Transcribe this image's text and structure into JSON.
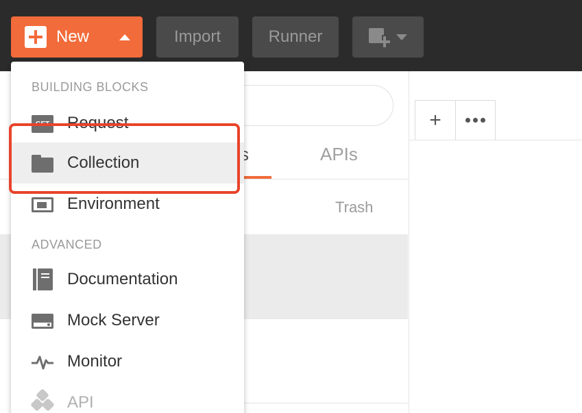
{
  "toolbar": {
    "new_label": "New",
    "import_label": "Import",
    "runner_label": "Runner",
    "accent_color": "#f26b3a"
  },
  "sidebar": {
    "tab_partial": "s",
    "tab_apis": "APIs",
    "trash_label": "Trash"
  },
  "menu": {
    "section_building": "BUILDING BLOCKS",
    "items_building": [
      {
        "label": "Request",
        "icon": "request-icon",
        "badge": "GET"
      },
      {
        "label": "Collection",
        "icon": "folder-icon"
      },
      {
        "label": "Environment",
        "icon": "environment-icon"
      }
    ],
    "section_advanced": "ADVANCED",
    "items_advanced": [
      {
        "label": "Documentation",
        "icon": "documentation-icon"
      },
      {
        "label": "Mock Server",
        "icon": "mock-server-icon"
      },
      {
        "label": "Monitor",
        "icon": "monitor-pulse-icon"
      },
      {
        "label": "API",
        "icon": "api-hexagons-icon"
      }
    ]
  },
  "highlight_color": "#e8432b"
}
